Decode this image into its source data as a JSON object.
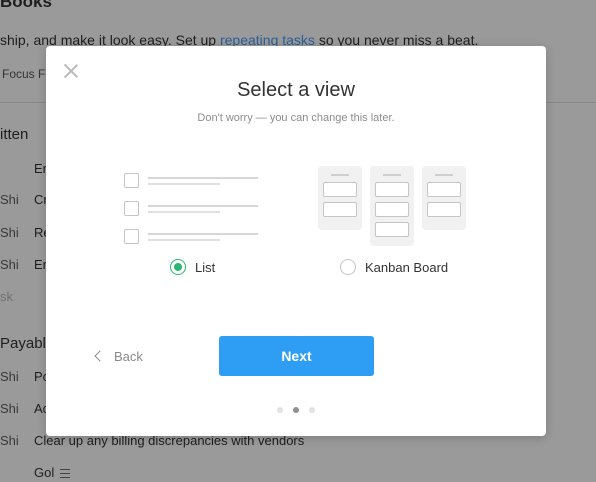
{
  "background": {
    "title": "Books",
    "subtitle_prefix": "ship, and make it look easy. Set up ",
    "subtitle_link": "repeating tasks",
    "subtitle_suffix": " so you never miss a beat.",
    "tabs": "Focus  F",
    "section1": "itten",
    "rows1": [
      {
        "who": "",
        "what": "Er"
      },
      {
        "who": "Shi",
        "what": "Cr"
      },
      {
        "who": "Shi",
        "what": "Re"
      },
      {
        "who": "Shi",
        "what": "Er"
      }
    ],
    "add_task": "sk",
    "section2": "Payable",
    "rows2": [
      {
        "who": "Shi",
        "what": "Po"
      },
      {
        "who": "Shi",
        "what": "Ac"
      },
      {
        "who": "Shi",
        "what": "Clear up any billing discrepancies with vendors"
      },
      {
        "who": "",
        "what": "Gol"
      }
    ]
  },
  "modal": {
    "title": "Select a view",
    "subtitle": "Don't worry — you can change this later.",
    "options": [
      {
        "label": "List",
        "selected": true
      },
      {
        "label": "Kanban Board",
        "selected": false
      }
    ],
    "back_label": "Back",
    "next_label": "Next",
    "pagination": {
      "total": 3,
      "current": 2
    },
    "accent_color": "#2d9ef4",
    "selected_color": "#2bb673"
  }
}
